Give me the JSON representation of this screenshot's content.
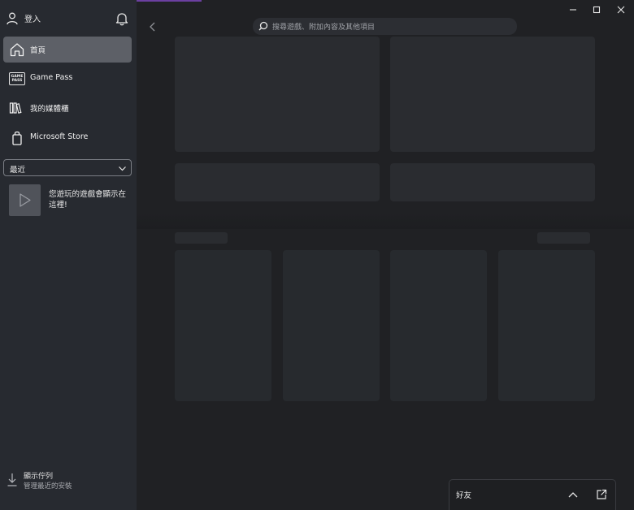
{
  "sidebar": {
    "signin_label": "登入",
    "nav": [
      {
        "label": "首頁",
        "icon": "home-icon",
        "active": true
      },
      {
        "label": "Game Pass",
        "icon": "game-pass-icon",
        "active": false
      },
      {
        "label": "我的媒體櫃",
        "icon": "library-icon",
        "active": false
      },
      {
        "label": "Microsoft Store",
        "icon": "store-bag-icon",
        "active": false
      }
    ],
    "game_pass_badge": [
      "GAME",
      "PASS"
    ],
    "recent": {
      "label": "最近",
      "empty_text": "您遊玩的遊戲會顯示在這裡!"
    },
    "queue": {
      "title": "顯示佇列",
      "subtitle": "管理最近的安裝"
    }
  },
  "search": {
    "placeholder": "搜尋遊戲、附加內容及其他項目"
  },
  "friends": {
    "label": "好友"
  },
  "colors": {
    "sidebar_bg": "#272a30",
    "content_bg": "#202124",
    "active_nav": "#5d6067",
    "accent": "#6b3fa0"
  }
}
